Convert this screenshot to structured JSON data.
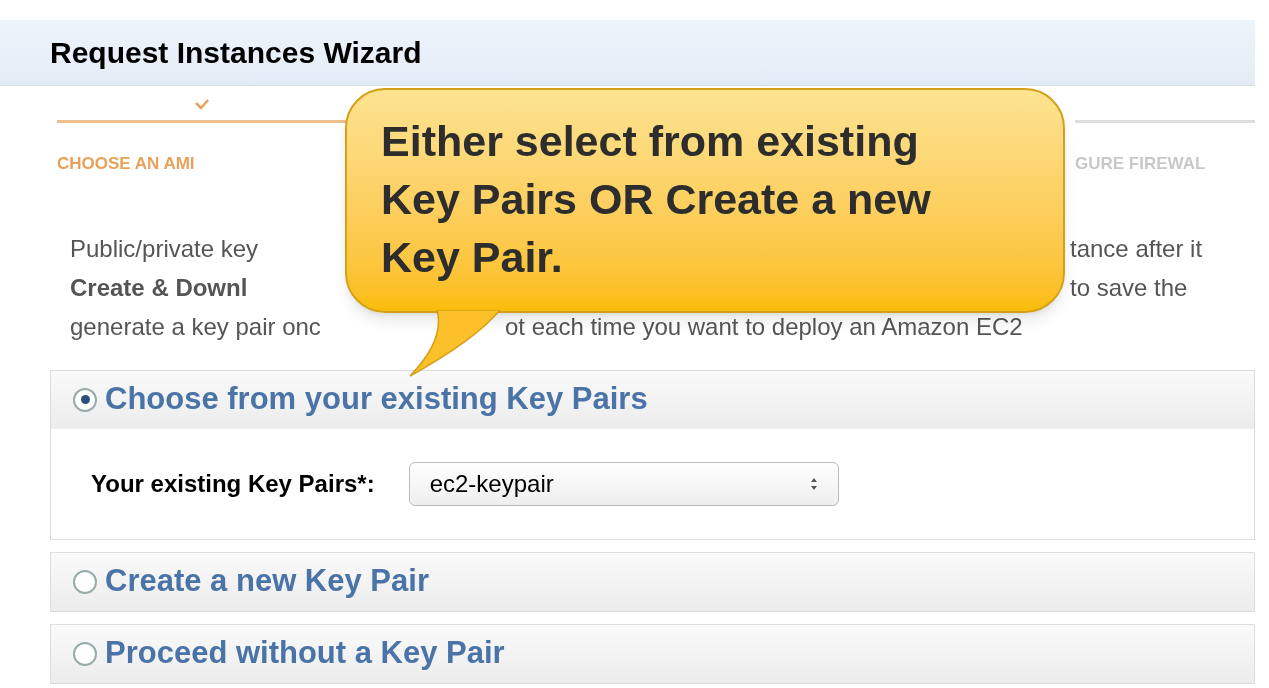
{
  "window": {
    "title": "Request Instances Wizard"
  },
  "steps": [
    {
      "label": "CHOOSE AN AMI",
      "selected": true
    },
    {
      "label": "GURE FIREWAL",
      "selected": false
    }
  ],
  "intro": {
    "lines": [
      {
        "left": "Public/private key",
        "right": "tance after it"
      },
      {
        "left": "**Create & Downl**",
        "right": "to save the"
      },
      {
        "left": "generate a key pair onc",
        "right": "ot each time you want to deploy an Amazon EC2"
      }
    ]
  },
  "callout": {
    "text": "Either select from existing Key Pairs OR Create a new Key Pair."
  },
  "options": [
    {
      "label": "Choose from your existing Key Pairs",
      "selected": true,
      "field": {
        "label": "Your existing Key Pairs*:",
        "value": "ec2-keypair"
      }
    },
    {
      "label": "Create a new Key Pair",
      "selected": false
    },
    {
      "label": "Proceed without a Key Pair",
      "selected": false
    }
  ]
}
